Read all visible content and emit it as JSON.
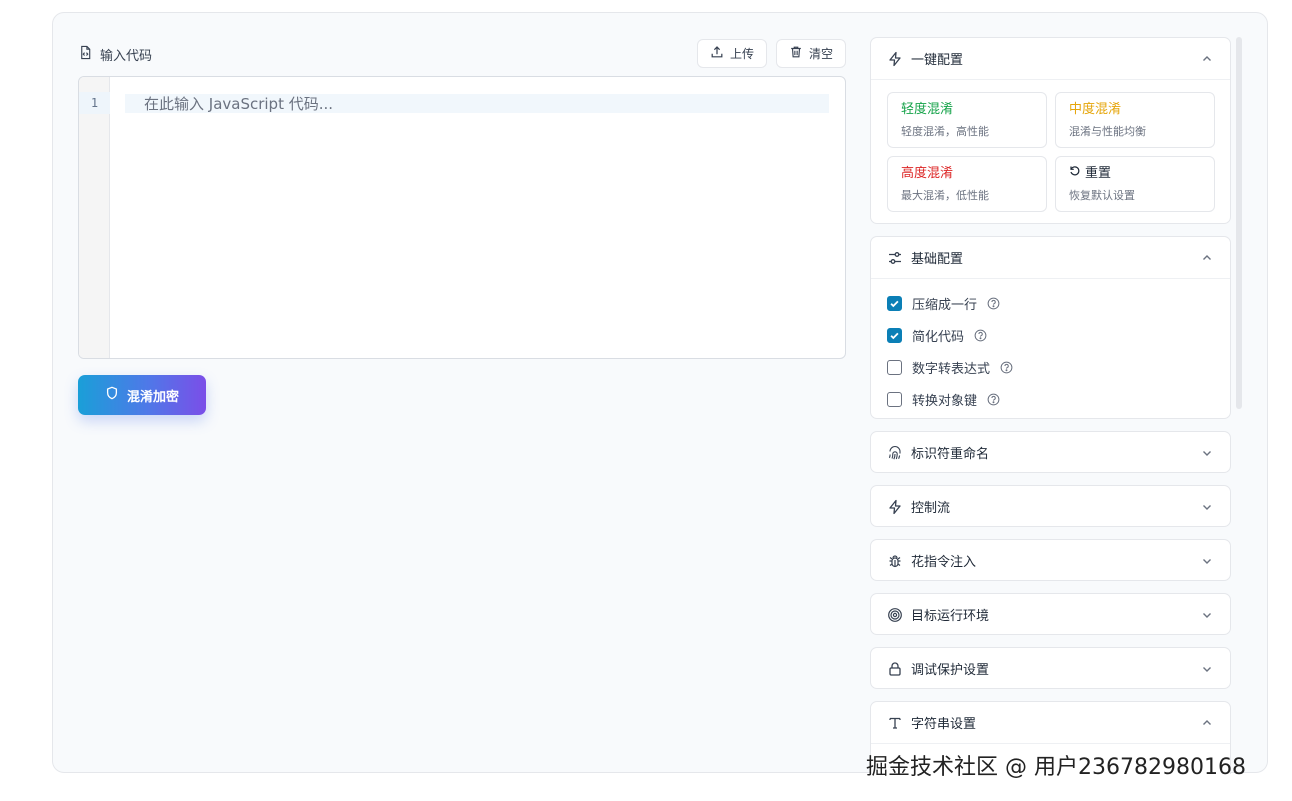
{
  "editor": {
    "title": "输入代码",
    "upload_label": "上传",
    "clear_label": "清空",
    "line_numbers": [
      "1"
    ],
    "placeholder": "在此输入 JavaScript 代码..."
  },
  "obfuscate_button": {
    "label": "混淆加密"
  },
  "panel": {
    "quick": {
      "title": "一键配置",
      "expanded": true,
      "presets": [
        {
          "title": "轻度混淆",
          "desc": "轻度混淆，高性能",
          "color": "#16a34a"
        },
        {
          "title": "中度混淆",
          "desc": "混淆与性能均衡",
          "color": "#eab308"
        },
        {
          "title": "高度混淆",
          "desc": "最大混淆，低性能",
          "color": "#dc2626"
        },
        {
          "title": "重置",
          "desc": "恢复默认设置",
          "color": "#1f2937"
        }
      ]
    },
    "basic": {
      "title": "基础配置",
      "expanded": true,
      "options": [
        {
          "label": "压缩成一行",
          "checked": true
        },
        {
          "label": "简化代码",
          "checked": true
        },
        {
          "label": "数字转表达式",
          "checked": false
        },
        {
          "label": "转换对象键",
          "checked": false
        }
      ]
    },
    "identifier": {
      "title": "标识符重命名",
      "expanded": false
    },
    "control_flow": {
      "title": "控制流",
      "expanded": false
    },
    "junk_code": {
      "title": "花指令注入",
      "expanded": false
    },
    "target": {
      "title": "目标运行环境",
      "expanded": false
    },
    "debug": {
      "title": "调试保护设置",
      "expanded": false
    },
    "strings": {
      "title": "字符串设置",
      "expanded": true
    }
  },
  "watermark": "掘金技术社区 @ 用户23678298016​8"
}
